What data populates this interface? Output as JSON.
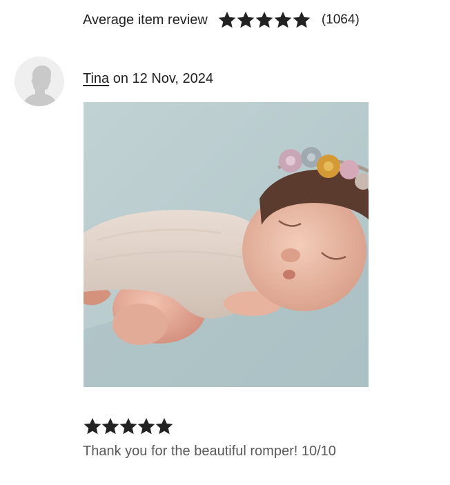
{
  "summary": {
    "label": "Average item review",
    "rating_stars": 5,
    "count_text": "(1064)"
  },
  "review": {
    "reviewer_name": "Tina",
    "date_text": " on 12 Nov, 2024",
    "rating_stars": 5,
    "text": "Thank you for the beautiful romper! 10/10",
    "photo_icon": "newborn-baby-photo"
  },
  "colors": {
    "star": "#222222",
    "text": "#222222",
    "muted_text": "#595959",
    "avatar_bg": "#efefef",
    "avatar_figure": "#c9c9c9"
  }
}
